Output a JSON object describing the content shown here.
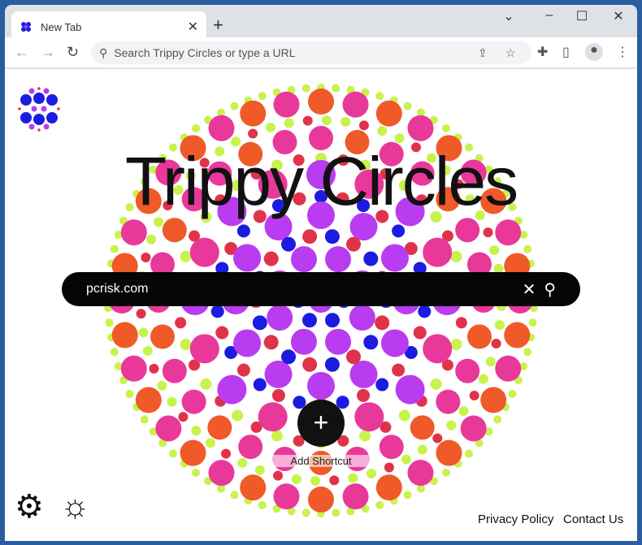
{
  "browser": {
    "tab_title": "New Tab",
    "omnibox_placeholder": "Search Trippy Circles or type a URL",
    "icons": [
      "back-arrow-icon",
      "forward-arrow-icon",
      "reload-icon",
      "search-icon",
      "share-icon",
      "star-icon",
      "puzzle-icon",
      "side-panel-icon",
      "profile-icon",
      "menu-icon"
    ]
  },
  "page": {
    "title": "Trippy Circles",
    "search_value": "pcrisk.com",
    "shortcut_label": "Add Shortcut",
    "links": [
      "Privacy Policy",
      "Contact Us"
    ]
  },
  "colors": {
    "pink": "#e8399b",
    "orange": "#ef5a28",
    "lime": "#c8f24c",
    "purple": "#b93cf0",
    "blue": "#1c1ce0",
    "red": "#e0334a"
  }
}
